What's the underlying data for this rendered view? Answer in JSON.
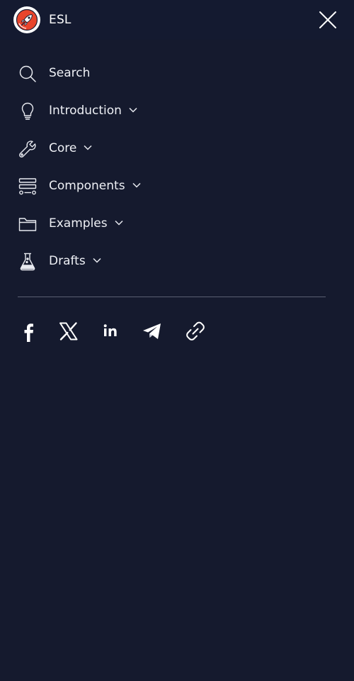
{
  "header": {
    "brand_name": "ESL",
    "logo_icon": "esl-rocket-logo",
    "close_icon": "close-icon"
  },
  "nav": {
    "items": [
      {
        "label": "Search",
        "icon": "search-icon",
        "expandable": false
      },
      {
        "label": "Introduction",
        "icon": "lightbulb-icon",
        "expandable": true
      },
      {
        "label": "Core",
        "icon": "wrench-icon",
        "expandable": true
      },
      {
        "label": "Components",
        "icon": "components-icon",
        "expandable": true
      },
      {
        "label": "Examples",
        "icon": "folder-icon",
        "expandable": true
      },
      {
        "label": "Drafts",
        "icon": "flask-icon",
        "expandable": true
      }
    ]
  },
  "social": {
    "links": [
      {
        "icon": "facebook-icon"
      },
      {
        "icon": "x-twitter-icon"
      },
      {
        "icon": "linkedin-icon"
      },
      {
        "icon": "telegram-icon"
      },
      {
        "icon": "copy-link-icon"
      }
    ]
  },
  "colors": {
    "background": "#151a2e",
    "header_background": "#141a30",
    "text": "#eef0f5",
    "divider": "#5a5f72",
    "logo_accent": "#e8452c"
  }
}
